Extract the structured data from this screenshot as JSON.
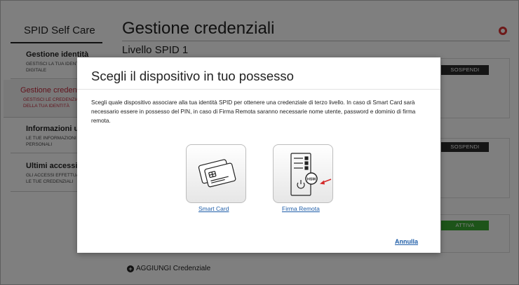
{
  "sidebar": {
    "title": "SPID Self Care",
    "items": [
      {
        "label": "Gestione identità",
        "sub": "GESTISCI LA TUA IDENTITÀ DIGITALE"
      },
      {
        "label": "Gestione credenziali",
        "sub": "GESTISCI LE CREDENZIALI DELLA TUA IDENTITÀ"
      },
      {
        "label": "Informazioni utente",
        "sub": "LE TUE INFORMAZIONI PERSONALI"
      },
      {
        "label": "Ultimi accessi",
        "sub": "GLI ACCESSI EFFETTUATI CON LE TUE CREDENZIALI"
      }
    ]
  },
  "main": {
    "title": "Gestione credenziali",
    "level": "Livello SPID 1",
    "buttons": {
      "sospendi_1": "SOSPENDI",
      "sospendi_2": "SOSPENDI",
      "attiva": "ATTIVA"
    },
    "add_credential": "AGGIUNGI Credenziale"
  },
  "modal": {
    "title": "Scegli il dispositivo in tuo possesso",
    "description": "Scegli quale dispositivo associare alla tua identità SPID per ottenere una credenziale di terzo livello. In caso di Smart Card sarà necessario essere in possesso del PIN, in caso di Firma Remota saranno necessarie nome utente, password e dominio di firma remota.",
    "options": [
      {
        "label": "Smart Card",
        "icon": "smart-card-icon"
      },
      {
        "label": "Firma Remota",
        "icon": "hsm-server-icon",
        "badge": "HSM"
      }
    ],
    "cancel": "Annulla"
  },
  "colors": {
    "accent_red": "#c3293b",
    "link_blue": "#1e5da8",
    "active_green": "#3aa832",
    "arrow_red": "#d42a2a"
  }
}
